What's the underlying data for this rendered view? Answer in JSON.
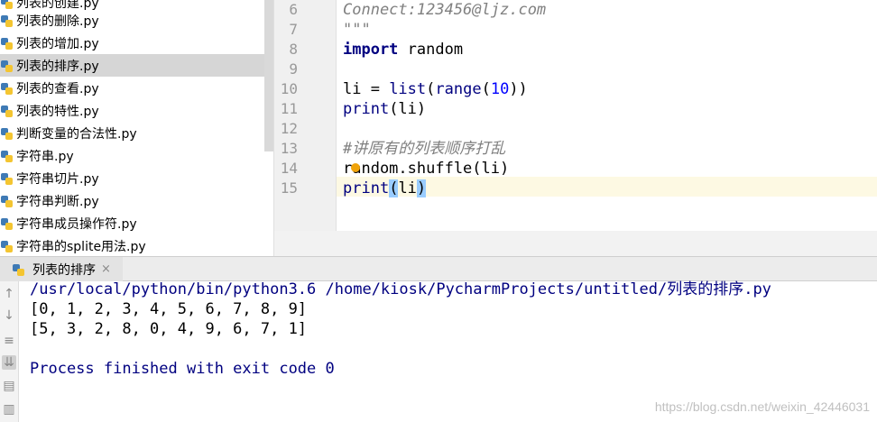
{
  "project_files": [
    "列表的创建.py",
    "列表的删除.py",
    "列表的增加.py",
    "列表的排序.py",
    "列表的查看.py",
    "列表的特性.py",
    "判断变量的合法性.py",
    "字符串.py",
    "字符串切片.py",
    "字符串判断.py",
    "字符串成员操作符.py",
    "字符串的splite用法.py"
  ],
  "editor": {
    "line_numbers": [
      "6",
      "7",
      "8",
      "9",
      "10",
      "11",
      "12",
      "13",
      "14",
      "15"
    ],
    "code": {
      "l6": "Connect:123456@ljz.com",
      "l7": "\"\"\"",
      "l8_kw": "import",
      "l8_rest": " random",
      "l10_a": "li = ",
      "l10_list": "list",
      "l10_b": "(",
      "l10_range": "range",
      "l10_c": "(",
      "l10_num": "10",
      "l10_d": "))",
      "l11_print": "print",
      "l11_rest": "(li)",
      "l13": "#讲原有的列表顺序打乱",
      "l14": "random.shuffle(li)",
      "l15_print": "print",
      "l15_open": "(",
      "l15_mid": "li",
      "l15_close": ")"
    }
  },
  "run": {
    "tab_label": "列表的排序",
    "tab_close": "×",
    "command": "/usr/local/python/bin/python3.6 /home/kiosk/PycharmProjects/untitled/列表的排序.py",
    "output": [
      "[0, 1, 2, 3, 4, 5, 6, 7, 8, 9]",
      "[5, 3, 2, 8, 0, 4, 9, 6, 7, 1]"
    ],
    "finish": "Process finished with exit code 0"
  },
  "watermark": "https://blog.csdn.net/weixin_42446031",
  "colors": {
    "keyword": "#000080",
    "number": "#0000ff",
    "comment": "#808080",
    "selected_row": "#d6d6d6"
  }
}
